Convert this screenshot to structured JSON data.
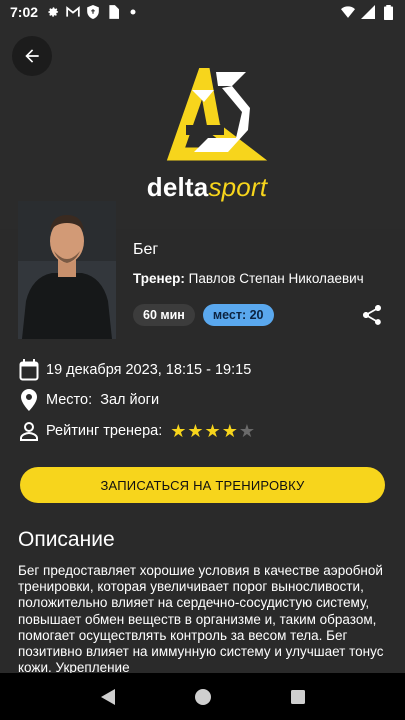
{
  "status_bar": {
    "time": "7:02",
    "icons_left": [
      "gear-icon",
      "gmail-icon",
      "shield-icon",
      "sim-card-icon",
      "dot-icon"
    ],
    "icons_right": [
      "wifi-icon",
      "signal-icon",
      "battery-icon"
    ]
  },
  "header": {
    "logo_bold": "delta",
    "logo_light": "sport",
    "accent_color": "#f7d51c"
  },
  "workout": {
    "title": "Бег",
    "coach_label": "Тренер:",
    "coach_name": "Павлов Степан Николаевич",
    "duration_chip": "60 мин",
    "spots_chip": "мест: 20",
    "date_time": "19 декабря 2023, 18:15 - 19:15",
    "place_label": "Место:",
    "place_value": "Зал йоги",
    "rating_label": "Рейтинг тренера:",
    "rating": 4,
    "rating_max": 5
  },
  "cta": {
    "label": "ЗАПИСАТЬСЯ НА ТРЕНИРОВКУ"
  },
  "description": {
    "title": "Описание",
    "text": "Бег предоставляет хорошие условия в качестве аэробной тренировки, которая увеличивает порог выносливости, положительно влияет на сердечно-сосудистую систему, повышает обмен веществ в организме и, таким образом, помогает осуществлять контроль за весом тела. Бег позитивно влияет на иммунную систему и улучшает тонус кожи. Укрепление"
  },
  "nav": {
    "buttons": [
      "back-triangle-icon",
      "home-circle-icon",
      "recents-square-icon"
    ]
  }
}
